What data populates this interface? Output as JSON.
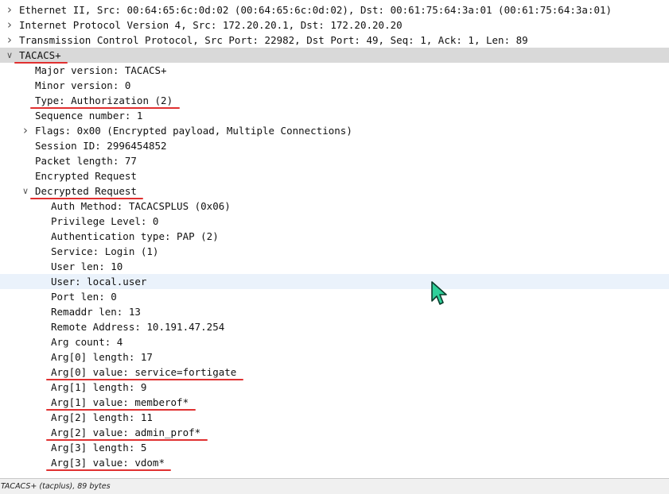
{
  "tree": {
    "rows": [
      {
        "text": "Ethernet II, Src: 00:64:65:6c:0d:02 (00:64:65:6c:0d:02), Dst: 00:61:75:64:3a:01 (00:61:75:64:3a:01)",
        "indent": 0,
        "expander": "collapsed"
      },
      {
        "text": "Internet Protocol Version 4, Src: 172.20.20.1, Dst: 172.20.20.20",
        "indent": 0,
        "expander": "collapsed"
      },
      {
        "text": "Transmission Control Protocol, Src Port: 22982, Dst Port: 49, Seq: 1, Ack: 1, Len: 89",
        "indent": 0,
        "expander": "collapsed"
      },
      {
        "text": "TACACS+",
        "indent": 0,
        "expander": "expanded",
        "selected": true,
        "underline": true
      },
      {
        "text": "Major version: TACACS+",
        "indent": 1
      },
      {
        "text": "Minor version: 0",
        "indent": 1
      },
      {
        "text": "Type: Authorization (2)",
        "indent": 1,
        "underline": true
      },
      {
        "text": "Sequence number: 1",
        "indent": 1
      },
      {
        "text": "Flags: 0x00 (Encrypted payload, Multiple Connections)",
        "indent": 1,
        "expander": "collapsed"
      },
      {
        "text": "Session ID: 2996454852",
        "indent": 1
      },
      {
        "text": "Packet length: 77",
        "indent": 1
      },
      {
        "text": "Encrypted Request",
        "indent": 1
      },
      {
        "text": "Decrypted Request",
        "indent": 1,
        "expander": "expanded",
        "underline": true
      },
      {
        "text": "Auth Method: TACACSPLUS (0x06)",
        "indent": 2
      },
      {
        "text": "Privilege Level: 0",
        "indent": 2
      },
      {
        "text": "Authentication type: PAP (2)",
        "indent": 2
      },
      {
        "text": "Service: Login (1)",
        "indent": 2
      },
      {
        "text": "User len: 10",
        "indent": 2
      },
      {
        "text": "User: local.user",
        "indent": 2,
        "hover": true
      },
      {
        "text": "Port len: 0",
        "indent": 2
      },
      {
        "text": "Remaddr len: 13",
        "indent": 2
      },
      {
        "text": "Remote Address: 10.191.47.254",
        "indent": 2
      },
      {
        "text": "Arg count: 4",
        "indent": 2
      },
      {
        "text": "Arg[0] length: 17",
        "indent": 2
      },
      {
        "text": "Arg[0] value: service=fortigate",
        "indent": 2,
        "underline": true
      },
      {
        "text": "Arg[1] length: 9",
        "indent": 2
      },
      {
        "text": "Arg[1] value: memberof*",
        "indent": 2,
        "underline": true
      },
      {
        "text": "Arg[2] length: 11",
        "indent": 2
      },
      {
        "text": "Arg[2] value: admin_prof*",
        "indent": 2,
        "underline": true
      },
      {
        "text": "Arg[3] length: 5",
        "indent": 2
      },
      {
        "text": "Arg[3] value: vdom*",
        "indent": 2,
        "underline": true
      }
    ]
  },
  "icons": {
    "collapsed": "chevron-right-icon",
    "expanded": "chevron-down-icon",
    "cursor": "mouse-pointer-icon"
  },
  "colors": {
    "underline": "#e03030",
    "selected_row": "#d9d9d9",
    "hover_row": "#eaf2fb",
    "cursor_fill": "#2fd09a"
  },
  "statusbar": {
    "text": "TACACS+ (tacplus), 89 bytes"
  }
}
